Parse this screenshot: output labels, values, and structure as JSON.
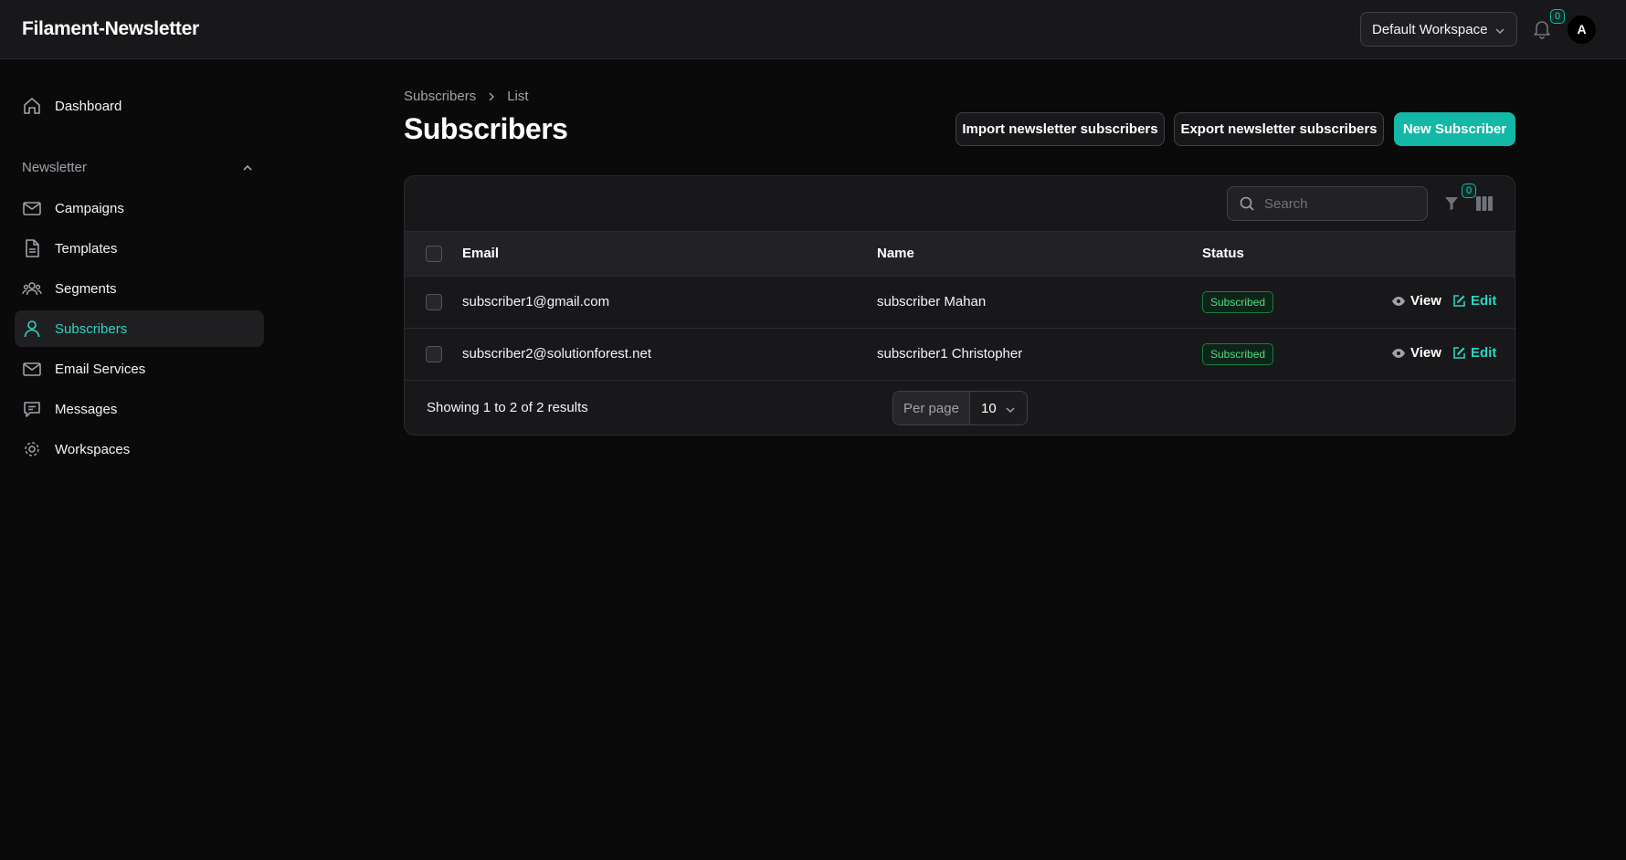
{
  "app": {
    "title": "Filament-Newsletter"
  },
  "topbar": {
    "workspace_label": "Default Workspace",
    "notifications_count": "0",
    "avatar_initial": "A"
  },
  "sidebar": {
    "dashboard": "Dashboard",
    "group_label": "Newsletter",
    "items": [
      {
        "label": "Campaigns",
        "icon": "envelope-icon"
      },
      {
        "label": "Templates",
        "icon": "document-icon"
      },
      {
        "label": "Segments",
        "icon": "users-group-icon"
      },
      {
        "label": "Subscribers",
        "icon": "user-icon",
        "active": true
      },
      {
        "label": "Email Services",
        "icon": "envelope-icon"
      },
      {
        "label": "Messages",
        "icon": "chat-bubble-icon"
      },
      {
        "label": "Workspaces",
        "icon": "cog-icon"
      }
    ]
  },
  "breadcrumb": {
    "parent": "Subscribers",
    "current": "List"
  },
  "page": {
    "title": "Subscribers",
    "import_button": "Import newsletter subscribers",
    "export_button": "Export newsletter subscribers",
    "new_button": "New Subscriber"
  },
  "table": {
    "search_placeholder": "Search",
    "filter_count": "0",
    "columns": {
      "email": "Email",
      "name": "Name",
      "status": "Status"
    },
    "rows": [
      {
        "email": "subscriber1@gmail.com",
        "name": "subscriber Mahan",
        "status": "Subscribed"
      },
      {
        "email": "subscriber2@solutionforest.net",
        "name": "subscriber1 Christopher",
        "status": "Subscribed"
      }
    ],
    "actions": {
      "view": "View",
      "edit": "Edit"
    },
    "footer": {
      "results_text": "Showing 1 to 2 of 2 results",
      "per_page_label": "Per page",
      "per_page_value": "10"
    }
  },
  "colors": {
    "accent": "#14b8a6",
    "background": "#0a0a0b",
    "surface": "#18181b",
    "success": "#4ade80"
  }
}
